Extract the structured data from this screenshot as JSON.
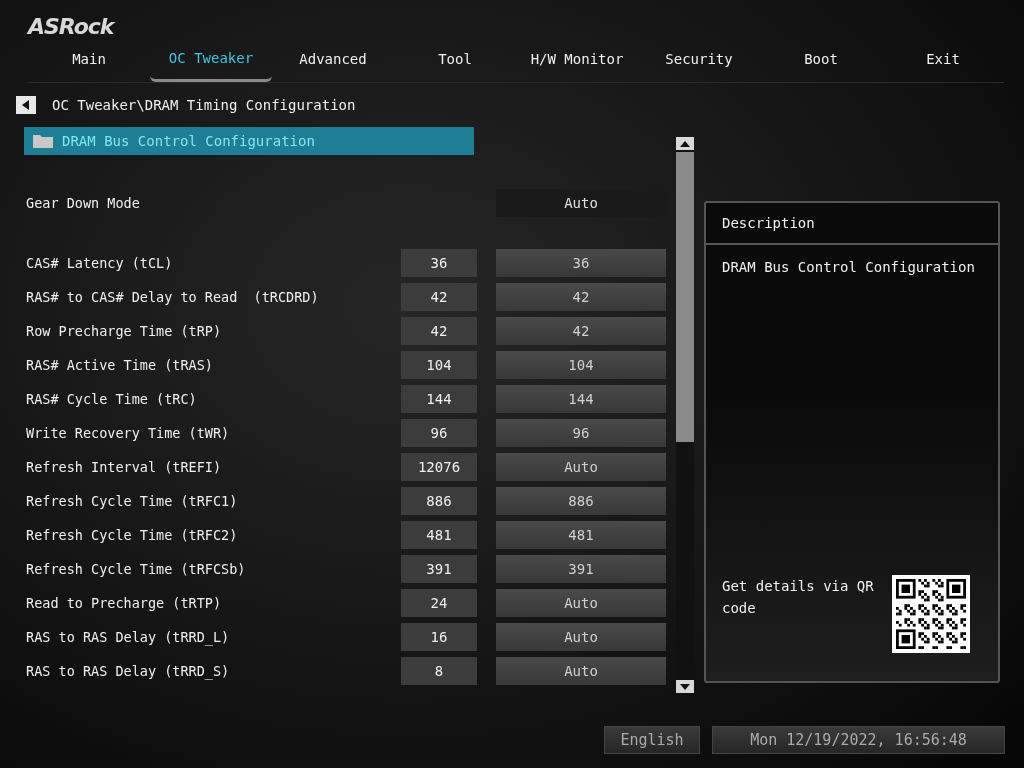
{
  "logo": "ASRock",
  "tabs": [
    {
      "label": "Main",
      "selected": false
    },
    {
      "label": "OC Tweaker",
      "selected": true
    },
    {
      "label": "Advanced",
      "selected": false
    },
    {
      "label": "Tool",
      "selected": false
    },
    {
      "label": "H/W Monitor",
      "selected": false
    },
    {
      "label": "Security",
      "selected": false
    },
    {
      "label": "Boot",
      "selected": false
    },
    {
      "label": "Exit",
      "selected": false
    }
  ],
  "breadcrumb": "OC Tweaker\\DRAM Timing Configuration",
  "submenu": {
    "label": "DRAM Bus Control Configuration",
    "selected": true
  },
  "settings": [
    {
      "kind": "option",
      "label": "Gear Down Mode",
      "value": "Auto"
    },
    {
      "kind": "timing",
      "label": "CAS# Latency (tCL)",
      "current": "36",
      "value": "36"
    },
    {
      "kind": "timing",
      "label": "RAS# to CAS# Delay to Read  (tRCDRD)",
      "current": "42",
      "value": "42"
    },
    {
      "kind": "timing",
      "label": "Row Precharge Time (tRP)",
      "current": "42",
      "value": "42"
    },
    {
      "kind": "timing",
      "label": "RAS# Active Time (tRAS)",
      "current": "104",
      "value": "104"
    },
    {
      "kind": "timing",
      "label": "RAS# Cycle Time (tRC)",
      "current": "144",
      "value": "144"
    },
    {
      "kind": "timing",
      "label": "Write Recovery Time (tWR)",
      "current": "96",
      "value": "96"
    },
    {
      "kind": "timing",
      "label": "Refresh Interval (tREFI)",
      "current": "12076",
      "value": "Auto"
    },
    {
      "kind": "timing",
      "label": "Refresh Cycle Time (tRFC1)",
      "current": "886",
      "value": "886"
    },
    {
      "kind": "timing",
      "label": "Refresh Cycle Time (tRFC2)",
      "current": "481",
      "value": "481"
    },
    {
      "kind": "timing",
      "label": "Refresh Cycle Time (tRFCSb)",
      "current": "391",
      "value": "391"
    },
    {
      "kind": "timing",
      "label": "Read to Precharge (tRTP)",
      "current": "24",
      "value": "Auto"
    },
    {
      "kind": "timing",
      "label": "RAS to RAS Delay (tRRD_L)",
      "current": "16",
      "value": "Auto"
    },
    {
      "kind": "timing",
      "label": "RAS to RAS Delay (tRRD_S)",
      "current": "8",
      "value": "Auto"
    }
  ],
  "description": {
    "title": "Description",
    "text": "DRAM Bus Control Configuration",
    "qr_hint": "Get details via QR code"
  },
  "status_bar": {
    "language": "English",
    "datetime": "Mon 12/19/2022, 16:56:48"
  }
}
